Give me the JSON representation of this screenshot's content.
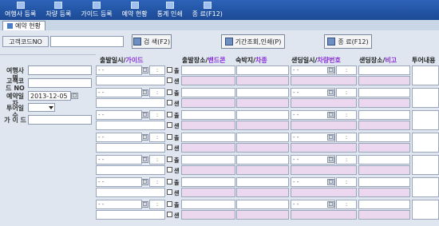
{
  "toolbar": {
    "items": [
      {
        "label": "여행사 등록",
        "icon": "register-agency-icon"
      },
      {
        "label": "차량 등록",
        "icon": "register-vehicle-icon"
      },
      {
        "label": "가이드 등록",
        "icon": "register-guide-icon"
      },
      {
        "label": "예약 현황",
        "icon": "reservation-status-icon"
      },
      {
        "label": "통계 인쇄",
        "icon": "print-statistics-icon"
      },
      {
        "label": "종 료(F12)",
        "icon": "exit-icon"
      }
    ]
  },
  "tab": {
    "label": "예약 현황"
  },
  "top": {
    "customer_code_label": "고객코드NO",
    "customer_code_value": "",
    "search_label": "검 색(F2)",
    "period_print_label": "기간조회,인쇄(P)",
    "exit_label": "종 료(F12)"
  },
  "form": {
    "agency_label": "여행사명",
    "customer_code_label": "고객코드 NO",
    "reservation_date_label": "예약일자",
    "reservation_date_value": "2013-12-05",
    "tour_count_label": "투어일수",
    "guide_label": "가 이 드"
  },
  "columns": {
    "departure_datetime": "출발일시/",
    "guide": "가이드",
    "departure_place": "출발장소/",
    "band": "밴드콘",
    "lodging": "숙박지/",
    "vehicle": "차종",
    "sending_datetime": "샌딩일시/",
    "vehicle_number": "차량번호",
    "sending_place": "샌딩장소/",
    "note": "비고",
    "tour_content": "투어내용"
  },
  "row_labels": {
    "depart": "출",
    "send": "샌"
  },
  "date_placeholder": "- -",
  "time_placeholder": ":",
  "calendar_glyph": "□",
  "row_count": 7
}
